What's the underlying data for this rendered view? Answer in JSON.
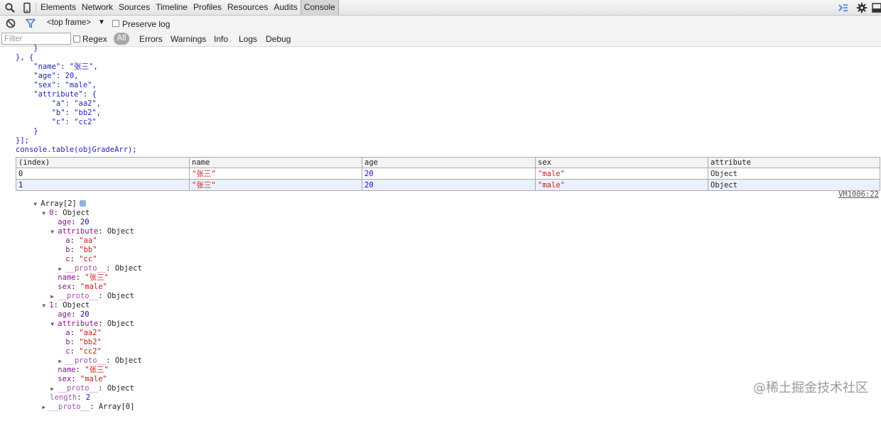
{
  "tabs": [
    "Elements",
    "Network",
    "Sources",
    "Timeline",
    "Profiles",
    "Resources",
    "Audits",
    "Console"
  ],
  "toolbar_icons": {
    "search": "search-icon",
    "device": "device-mode-icon",
    "drawer": "drawer-icon",
    "settings": "gear-icon",
    "dock": "dock-icon"
  },
  "console_toolbar": {
    "frame": "<top frame>",
    "preserve_log": "Preserve log"
  },
  "filter": {
    "placeholder": "Filter",
    "regex": "Regex",
    "levels": [
      "All",
      "Errors",
      "Warnings",
      "Info",
      "Logs",
      "Debug"
    ]
  },
  "code_lines": [
    "    }",
    "}, {",
    "    \"name\": \"张三\",",
    "    \"age\": 20,",
    "    \"sex\": \"male\",",
    "    \"attribute\": {",
    "        \"a\": \"aa2\",",
    "        \"b\": \"bb2\",",
    "        \"c\": \"cc2\"",
    "    }",
    "}];",
    "console.table(objGradeArr);"
  ],
  "table": {
    "columns": [
      "(index)",
      "name",
      "age",
      "sex",
      "attribute"
    ],
    "rows": [
      [
        "0",
        "\"张三\"",
        "20",
        "\"male\"",
        "Object"
      ],
      [
        "1",
        "\"张三\"",
        "20",
        "\"male\"",
        "Object"
      ]
    ]
  },
  "source_link": "VM1006:22",
  "tree": {
    "root": "Array[2]",
    "items": [
      {
        "head_key": "0",
        "head_val": "Object",
        "age_key": "age",
        "age_val": "20",
        "attr_key": "attribute",
        "attr_val": "Object",
        "a_key": "a",
        "a_val": "\"aa\"",
        "b_key": "b",
        "b_val": "\"bb\"",
        "c_key": "c",
        "c_val": "\"cc\"",
        "inner_proto_key": "__proto__",
        "inner_proto_val": "Object",
        "name_key": "name",
        "name_val": "\"张三\"",
        "sex_key": "sex",
        "sex_val": "\"male\"",
        "proto_key": "__proto__",
        "proto_val": "Object"
      },
      {
        "head_key": "1",
        "head_val": "Object",
        "age_key": "age",
        "age_val": "20",
        "attr_key": "attribute",
        "attr_val": "Object",
        "a_key": "a",
        "a_val": "\"aa2\"",
        "b_key": "b",
        "b_val": "\"bb2\"",
        "c_key": "c",
        "c_val": "\"cc2\"",
        "inner_proto_key": "__proto__",
        "inner_proto_val": "Object",
        "name_key": "name",
        "name_val": "\"张三\"",
        "sex_key": "sex",
        "sex_val": "\"male\"",
        "proto_key": "__proto__",
        "proto_val": "Object"
      }
    ],
    "length_key": "length",
    "length_val": "2",
    "root_proto_key": "__proto__",
    "root_proto_val": "Array[0]"
  },
  "watermark": "@稀土掘金技术社区"
}
